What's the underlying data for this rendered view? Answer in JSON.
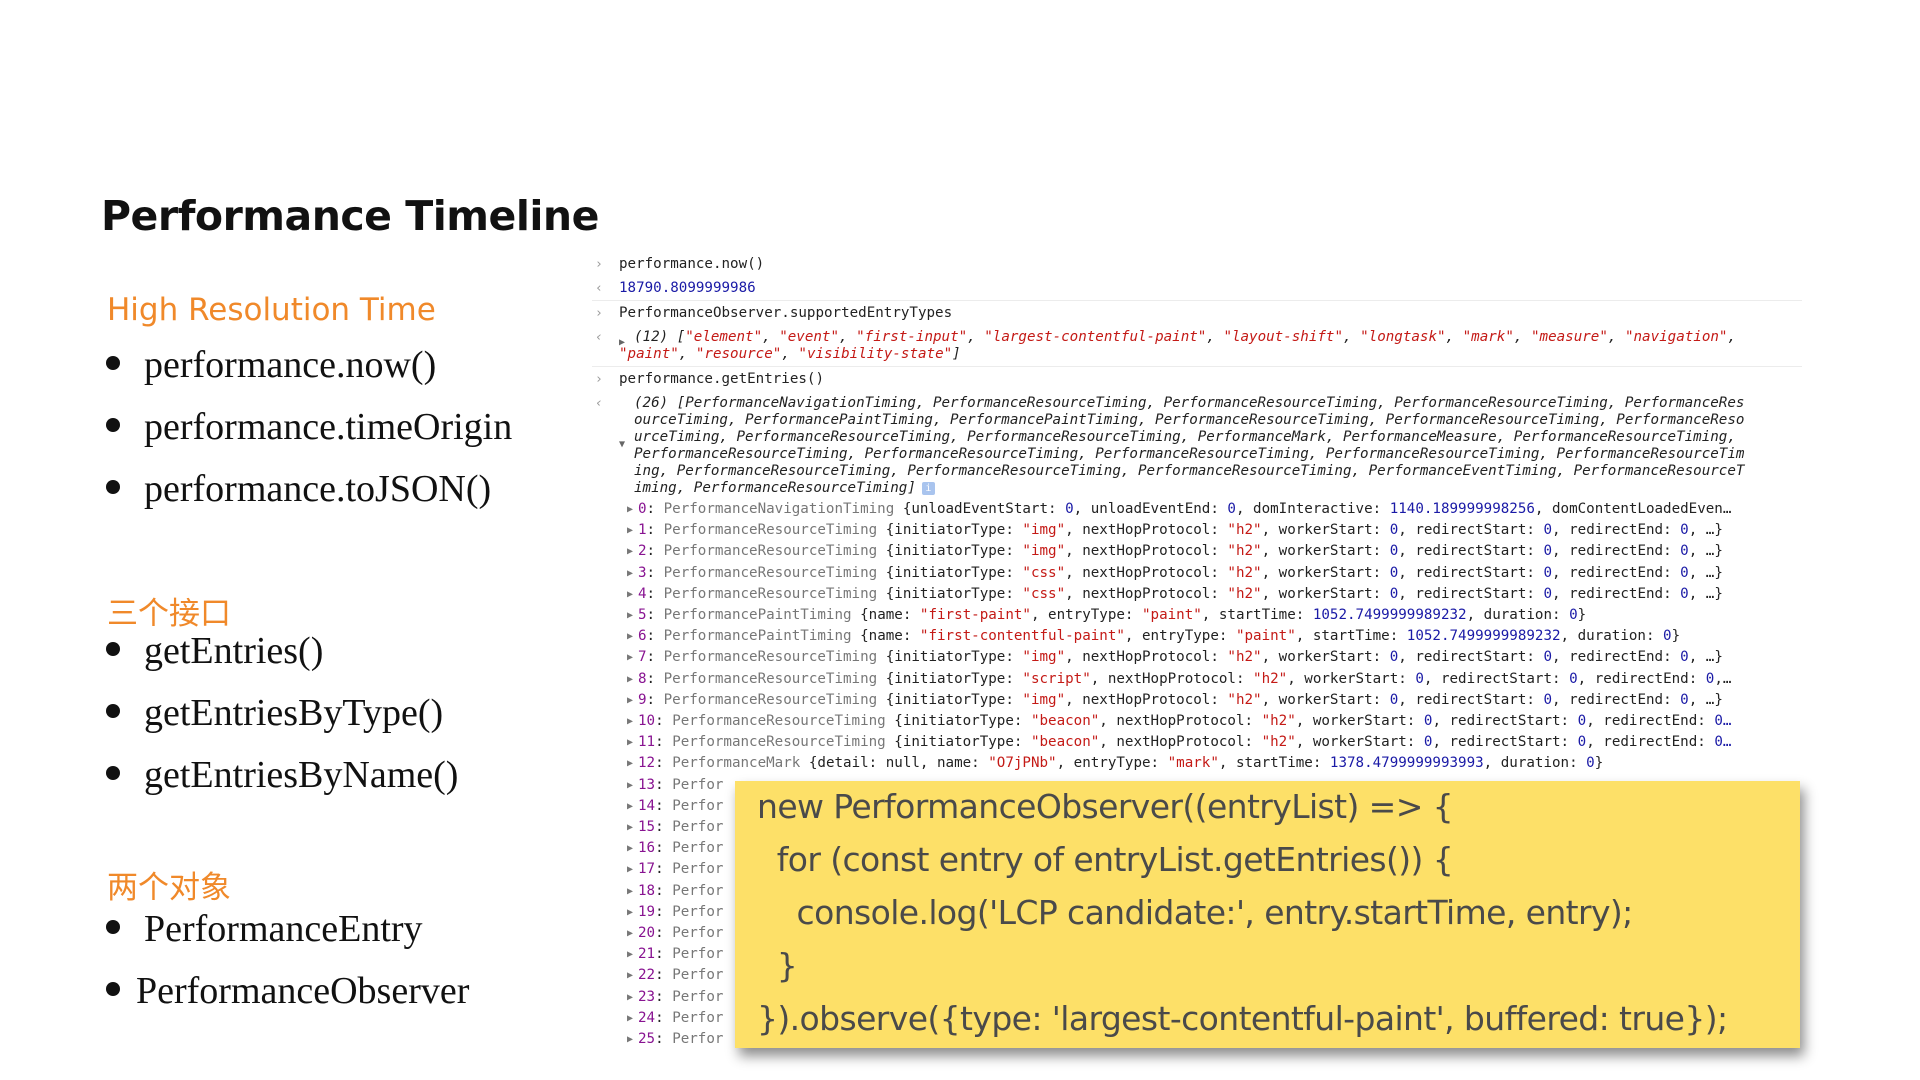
{
  "slide": {
    "title": "Performance Timeline",
    "sections": [
      {
        "heading": "High Resolution Time",
        "items": [
          "performance.now()",
          "performance.timeOrigin",
          "performance.toJSON()"
        ]
      },
      {
        "heading": "三个接口",
        "items": [
          "getEntries()",
          "getEntriesByType()",
          "getEntriesByName()"
        ]
      },
      {
        "heading": "两个对象",
        "items": [
          "PerformanceEntry",
          "PerformanceObserver"
        ]
      }
    ]
  },
  "console": {
    "input_prompt_icon": "chevron-right-icon",
    "output_prompt_icon": "chevron-left-icon",
    "cmd1": "performance.now()",
    "out1": "18790.8099999986",
    "cmd2": "PerformanceObserver.supportedEntryTypes",
    "out2_count": "(12)",
    "out2_line1_types": [
      "element",
      "event",
      "first-input",
      "largest-contentful-paint",
      "layout-shift",
      "longtask",
      "mark",
      "measure",
      "navigation"
    ],
    "out2_line2_types": [
      "paint",
      "resource",
      "visibility-state"
    ],
    "cmd3": "performance.getEntries()",
    "out3_summary_lines": [
      "(26) [PerformanceNavigationTiming, PerformanceResourceTiming, PerformanceResourceTiming, PerformanceResourceTiming, PerformanceRes",
      "ourceTiming, PerformancePaintTiming, PerformancePaintTiming, PerformanceResourceTiming, PerformanceResourceTiming, PerformanceReso",
      "urceTiming, PerformanceResourceTiming, PerformanceResourceTiming, PerformanceMark, PerformanceMeasure, PerformanceResourceTiming,",
      "PerformanceResourceTiming, PerformanceResourceTiming, PerformanceResourceTiming, PerformanceResourceTiming, PerformanceResourceTim",
      "ing, PerformanceResourceTiming, PerformanceResourceTiming, PerformanceResourceTiming, PerformanceEventTiming, PerformanceResourceT",
      "iming, PerformanceResourceTiming]"
    ],
    "info_badge": "i",
    "entries": [
      {
        "index": "0",
        "type": "PerformanceNavigationTiming",
        "parts": [
          [
            "k",
            "{unloadEventStart: "
          ],
          [
            "n",
            "0"
          ],
          [
            "k",
            ", unloadEventEnd: "
          ],
          [
            "n",
            "0"
          ],
          [
            "k",
            ", domInteractive: "
          ],
          [
            "n",
            "1140.189999998256"
          ],
          [
            "k",
            ", domContentLoadedEven…"
          ]
        ]
      },
      {
        "index": "1",
        "type": "PerformanceResourceTiming",
        "parts": [
          [
            "k",
            "{initiatorType: "
          ],
          [
            "s",
            "\"img\""
          ],
          [
            "k",
            ", nextHopProtocol: "
          ],
          [
            "s",
            "\"h2\""
          ],
          [
            "k",
            ", workerStart: "
          ],
          [
            "n",
            "0"
          ],
          [
            "k",
            ", redirectStart: "
          ],
          [
            "n",
            "0"
          ],
          [
            "k",
            ", redirectEnd: "
          ],
          [
            "n",
            "0"
          ],
          [
            "k",
            ", …}"
          ]
        ]
      },
      {
        "index": "2",
        "type": "PerformanceResourceTiming",
        "parts": [
          [
            "k",
            "{initiatorType: "
          ],
          [
            "s",
            "\"img\""
          ],
          [
            "k",
            ", nextHopProtocol: "
          ],
          [
            "s",
            "\"h2\""
          ],
          [
            "k",
            ", workerStart: "
          ],
          [
            "n",
            "0"
          ],
          [
            "k",
            ", redirectStart: "
          ],
          [
            "n",
            "0"
          ],
          [
            "k",
            ", redirectEnd: "
          ],
          [
            "n",
            "0"
          ],
          [
            "k",
            ", …}"
          ]
        ]
      },
      {
        "index": "3",
        "type": "PerformanceResourceTiming",
        "parts": [
          [
            "k",
            "{initiatorType: "
          ],
          [
            "s",
            "\"css\""
          ],
          [
            "k",
            ", nextHopProtocol: "
          ],
          [
            "s",
            "\"h2\""
          ],
          [
            "k",
            ", workerStart: "
          ],
          [
            "n",
            "0"
          ],
          [
            "k",
            ", redirectStart: "
          ],
          [
            "n",
            "0"
          ],
          [
            "k",
            ", redirectEnd: "
          ],
          [
            "n",
            "0"
          ],
          [
            "k",
            ", …}"
          ]
        ]
      },
      {
        "index": "4",
        "type": "PerformanceResourceTiming",
        "parts": [
          [
            "k",
            "{initiatorType: "
          ],
          [
            "s",
            "\"css\""
          ],
          [
            "k",
            ", nextHopProtocol: "
          ],
          [
            "s",
            "\"h2\""
          ],
          [
            "k",
            ", workerStart: "
          ],
          [
            "n",
            "0"
          ],
          [
            "k",
            ", redirectStart: "
          ],
          [
            "n",
            "0"
          ],
          [
            "k",
            ", redirectEnd: "
          ],
          [
            "n",
            "0"
          ],
          [
            "k",
            ", …}"
          ]
        ]
      },
      {
        "index": "5",
        "type": "PerformancePaintTiming",
        "parts": [
          [
            "k",
            "{name: "
          ],
          [
            "s",
            "\"first-paint\""
          ],
          [
            "k",
            ", entryType: "
          ],
          [
            "s",
            "\"paint\""
          ],
          [
            "k",
            ", startTime: "
          ],
          [
            "n",
            "1052.7499999989232"
          ],
          [
            "k",
            ", duration: "
          ],
          [
            "n",
            "0"
          ],
          [
            "k",
            "}"
          ]
        ]
      },
      {
        "index": "6",
        "type": "PerformancePaintTiming",
        "parts": [
          [
            "k",
            "{name: "
          ],
          [
            "s",
            "\"first-contentful-paint\""
          ],
          [
            "k",
            ", entryType: "
          ],
          [
            "s",
            "\"paint\""
          ],
          [
            "k",
            ", startTime: "
          ],
          [
            "n",
            "1052.7499999989232"
          ],
          [
            "k",
            ", duration: "
          ],
          [
            "n",
            "0"
          ],
          [
            "k",
            "}"
          ]
        ]
      },
      {
        "index": "7",
        "type": "PerformanceResourceTiming",
        "parts": [
          [
            "k",
            "{initiatorType: "
          ],
          [
            "s",
            "\"img\""
          ],
          [
            "k",
            ", nextHopProtocol: "
          ],
          [
            "s",
            "\"h2\""
          ],
          [
            "k",
            ", workerStart: "
          ],
          [
            "n",
            "0"
          ],
          [
            "k",
            ", redirectStart: "
          ],
          [
            "n",
            "0"
          ],
          [
            "k",
            ", redirectEnd: "
          ],
          [
            "n",
            "0"
          ],
          [
            "k",
            ", …}"
          ]
        ]
      },
      {
        "index": "8",
        "type": "PerformanceResourceTiming",
        "parts": [
          [
            "k",
            "{initiatorType: "
          ],
          [
            "s",
            "\"script\""
          ],
          [
            "k",
            ", nextHopProtocol: "
          ],
          [
            "s",
            "\"h2\""
          ],
          [
            "k",
            ", workerStart: "
          ],
          [
            "n",
            "0"
          ],
          [
            "k",
            ", redirectStart: "
          ],
          [
            "n",
            "0"
          ],
          [
            "k",
            ", redirectEnd: "
          ],
          [
            "n",
            "0"
          ],
          [
            "k",
            ",…"
          ]
        ]
      },
      {
        "index": "9",
        "type": "PerformanceResourceTiming",
        "parts": [
          [
            "k",
            "{initiatorType: "
          ],
          [
            "s",
            "\"img\""
          ],
          [
            "k",
            ", nextHopProtocol: "
          ],
          [
            "s",
            "\"h2\""
          ],
          [
            "k",
            ", workerStart: "
          ],
          [
            "n",
            "0"
          ],
          [
            "k",
            ", redirectStart: "
          ],
          [
            "n",
            "0"
          ],
          [
            "k",
            ", redirectEnd: "
          ],
          [
            "n",
            "0"
          ],
          [
            "k",
            ", …}"
          ]
        ]
      },
      {
        "index": "10",
        "type": "PerformanceResourceTiming",
        "parts": [
          [
            "k",
            "{initiatorType: "
          ],
          [
            "s",
            "\"beacon\""
          ],
          [
            "k",
            ", nextHopProtocol: "
          ],
          [
            "s",
            "\"h2\""
          ],
          [
            "k",
            ", workerStart: "
          ],
          [
            "n",
            "0"
          ],
          [
            "k",
            ", redirectStart: "
          ],
          [
            "n",
            "0"
          ],
          [
            "k",
            ", redirectEnd: "
          ],
          [
            "n",
            "0…"
          ]
        ]
      },
      {
        "index": "11",
        "type": "PerformanceResourceTiming",
        "parts": [
          [
            "k",
            "{initiatorType: "
          ],
          [
            "s",
            "\"beacon\""
          ],
          [
            "k",
            ", nextHopProtocol: "
          ],
          [
            "s",
            "\"h2\""
          ],
          [
            "k",
            ", workerStart: "
          ],
          [
            "n",
            "0"
          ],
          [
            "k",
            ", redirectStart: "
          ],
          [
            "n",
            "0"
          ],
          [
            "k",
            ", redirectEnd: "
          ],
          [
            "n",
            "0…"
          ]
        ]
      },
      {
        "index": "12",
        "type": "PerformanceMark",
        "parts": [
          [
            "k",
            "{detail: null, name: "
          ],
          [
            "s",
            "\"O7jPNb\""
          ],
          [
            "k",
            ", entryType: "
          ],
          [
            "s",
            "\"mark\""
          ],
          [
            "k",
            ", startTime: "
          ],
          [
            "n",
            "1378.4799999993993"
          ],
          [
            "k",
            ", duration: "
          ],
          [
            "n",
            "0"
          ],
          [
            "k",
            "}"
          ]
        ]
      },
      {
        "index": "13",
        "type": "Perfor",
        "parts": []
      },
      {
        "index": "14",
        "type": "Perfor",
        "parts": []
      },
      {
        "index": "15",
        "type": "Perfor",
        "parts": []
      },
      {
        "index": "16",
        "type": "Perfor",
        "parts": []
      },
      {
        "index": "17",
        "type": "Perfor",
        "parts": []
      },
      {
        "index": "18",
        "type": "Perfor",
        "parts": []
      },
      {
        "index": "19",
        "type": "Perfor",
        "parts": []
      },
      {
        "index": "20",
        "type": "Perfor",
        "parts": []
      },
      {
        "index": "21",
        "type": "Perfor",
        "parts": []
      },
      {
        "index": "22",
        "type": "Perfor",
        "parts": []
      },
      {
        "index": "23",
        "type": "Perfor",
        "parts": []
      },
      {
        "index": "24",
        "type": "Perfor",
        "parts": []
      },
      {
        "index": "25",
        "type": "Perfor",
        "parts": []
      }
    ]
  },
  "code_note": {
    "lines": [
      "new PerformanceObserver((entryList) => {",
      "  for (const entry of entryList.getEntries()) {",
      "    console.log('LCP candidate:', entry.startTime, entry);",
      "  }",
      "}).observe({type: 'largest-contentful-paint', buffered: true});"
    ]
  },
  "colors": {
    "accent_orange": "#f0892a",
    "note_yellow": "#fde068",
    "console_number": "#1a1aa6",
    "console_string": "#c41a16",
    "console_index": "#881391"
  }
}
